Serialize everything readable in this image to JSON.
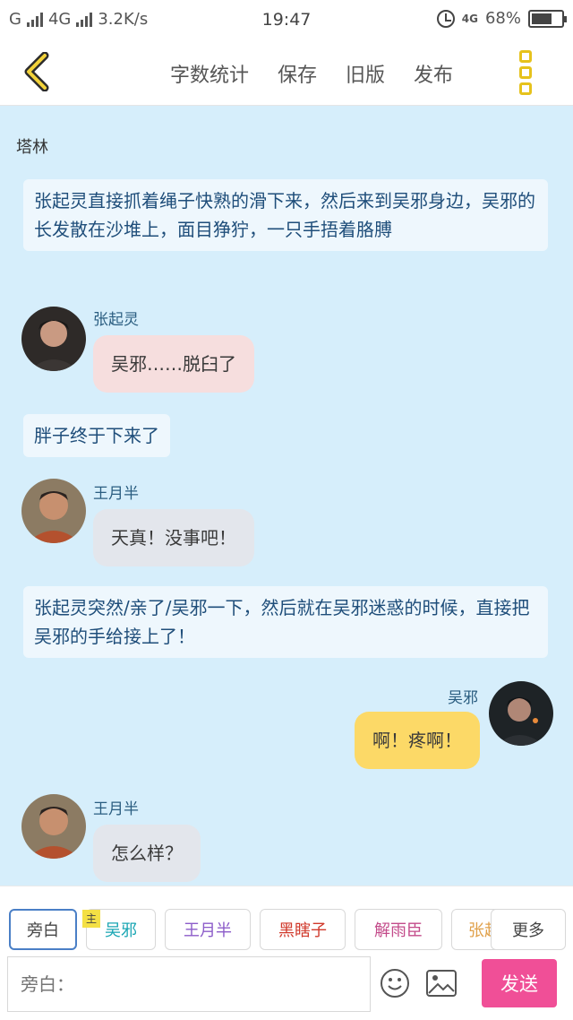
{
  "status": {
    "carrier1": "G",
    "carrier2": "4G",
    "speed": "3.2K/s",
    "time": "19:47",
    "net_badge": "4G",
    "battery": "68%",
    "battery_level": 0.68
  },
  "toolbar": {
    "actions": [
      "字数统计",
      "保存",
      "旧版",
      "发布"
    ]
  },
  "scene_label": "塔林",
  "messages": [
    {
      "type": "narration",
      "text": "张起灵直接抓着绳子快熟的滑下来，然后来到吴邪身边，吴邪的长发散在沙堆上，面目狰狞，一只手捂着胳膊"
    },
    {
      "type": "char",
      "side": "left",
      "name": "张起灵",
      "text": "吴邪……脱臼了",
      "bubble_color": "#f6dede"
    },
    {
      "type": "narration",
      "text": "胖子终于下来了"
    },
    {
      "type": "char",
      "side": "left",
      "name": "王月半",
      "text": "天真！没事吧！",
      "bubble_color": "#e3e6ec"
    },
    {
      "type": "narration",
      "text": "张起灵突然/亲了/吴邪一下，然后就在吴邪迷惑的时候，直接把吴邪的手给接上了！"
    },
    {
      "type": "char",
      "side": "right",
      "name": "吴邪",
      "text": "啊！疼啊！",
      "bubble_color": "#fcd967"
    },
    {
      "type": "char",
      "side": "left",
      "name": "王月半",
      "text": "怎么样？",
      "bubble_color": "#e3e6ec"
    }
  ],
  "characters": {
    "narrator": "旁白",
    "lead_tag": "主",
    "wuxie": "吴邪",
    "wangyueban": "王月半",
    "heixiazi": "黑瞎子",
    "xieyuchen": "解雨臣",
    "partial": "张起",
    "more": "更多"
  },
  "colors": {
    "wuxie": "#1aa6b3",
    "wangyueban": "#8c5cc9",
    "heixiazi": "#d0392b",
    "xieyuchen": "#c34b8a",
    "partial": "#e0a04a"
  },
  "input": {
    "placeholder": "旁白：",
    "send_label": "发送"
  }
}
